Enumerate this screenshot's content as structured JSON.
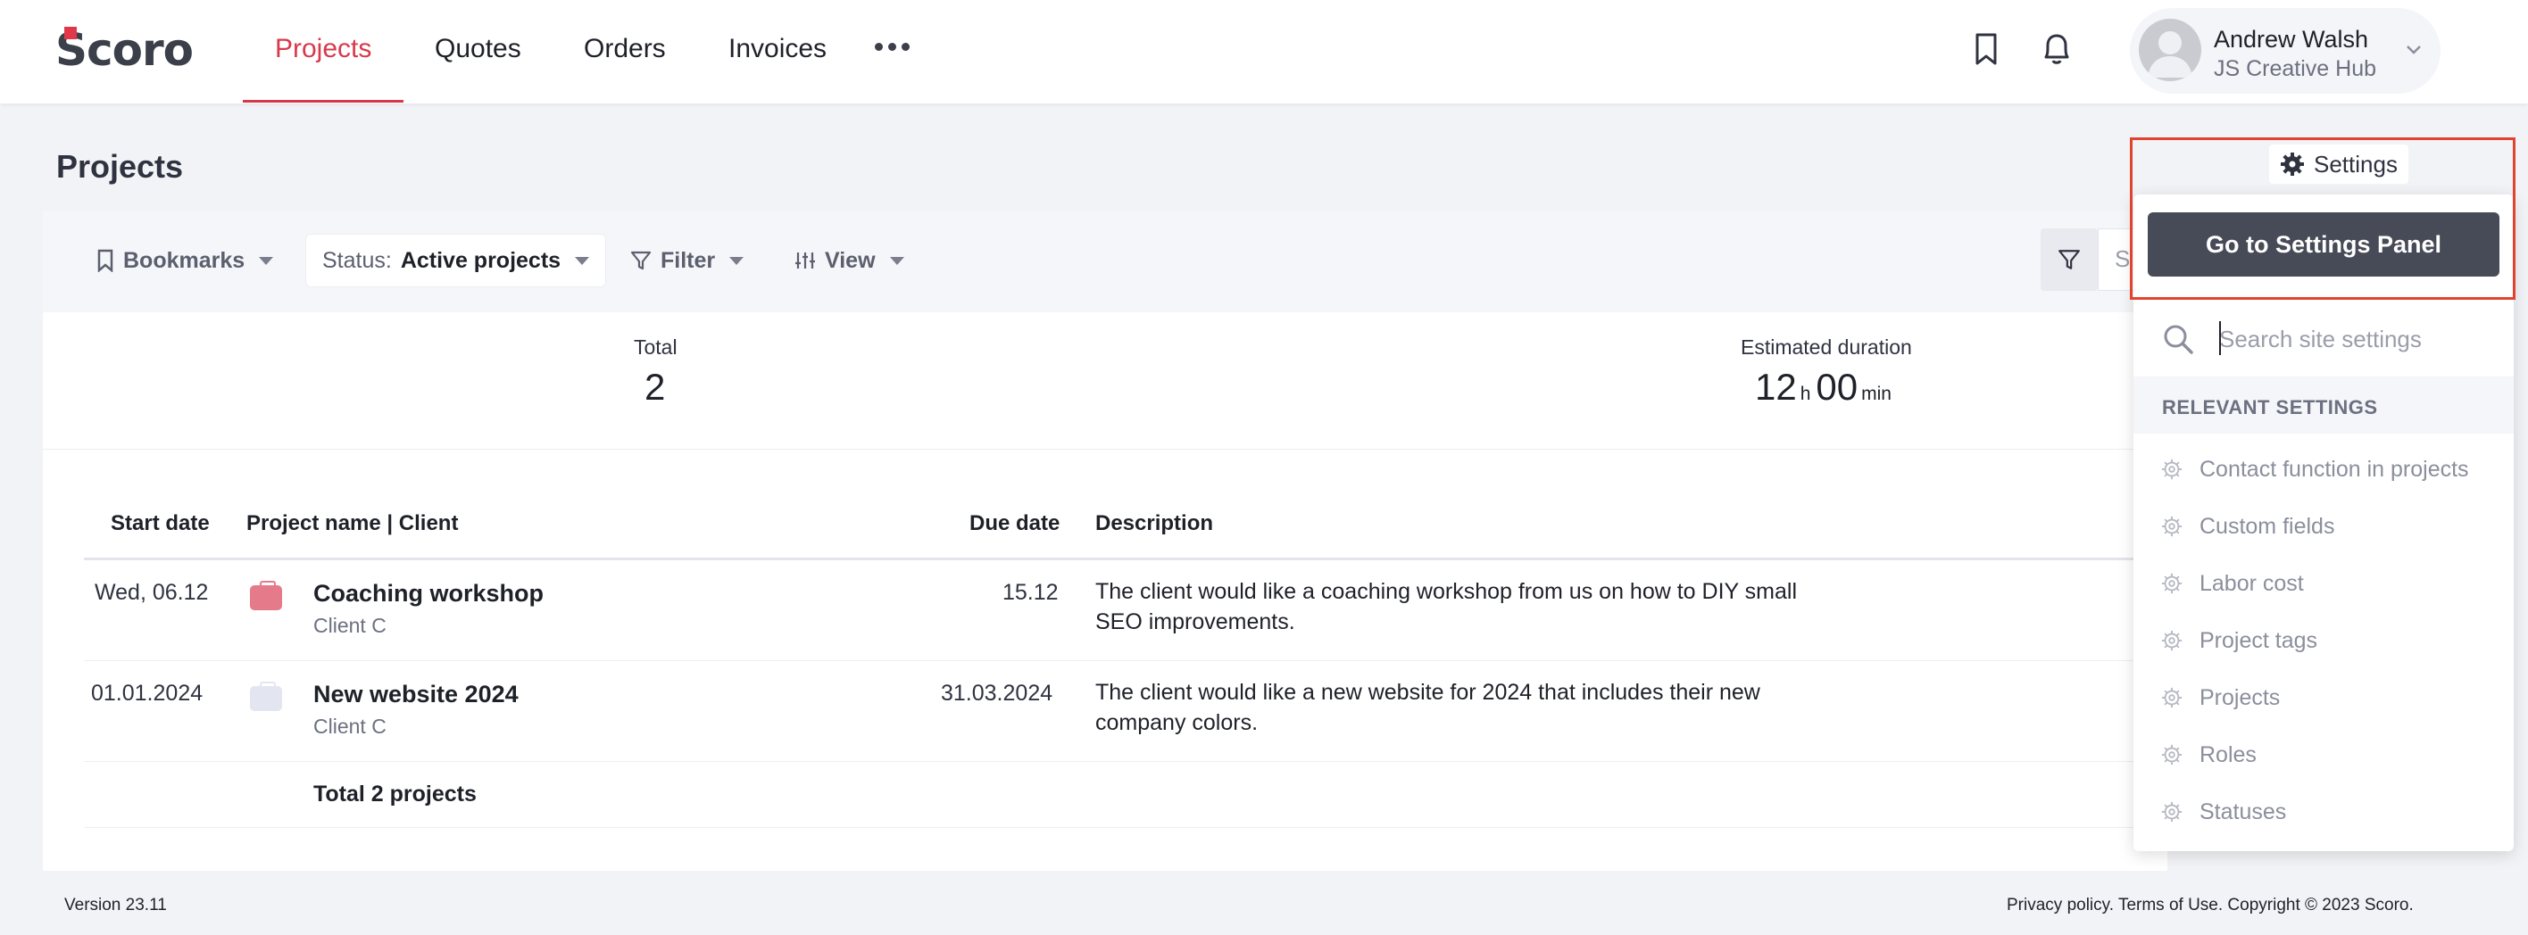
{
  "app": {
    "logo_text": "Scoro"
  },
  "nav": {
    "items": [
      {
        "label": "Projects",
        "active": true
      },
      {
        "label": "Quotes"
      },
      {
        "label": "Orders"
      },
      {
        "label": "Invoices"
      }
    ],
    "more_icon": "ellipsis-icon",
    "bookmark_icon": "bookmark-icon",
    "bell_icon": "bell-icon"
  },
  "user": {
    "name": "Andrew Walsh",
    "company": "JS Creative Hub"
  },
  "page": {
    "title": "Projects"
  },
  "toolbar": {
    "bookmarks": "Bookmarks",
    "status_prefix": "Status:",
    "status_value": "Active projects",
    "filter": "Filter",
    "view": "View",
    "search_stub": "S"
  },
  "stats": {
    "total_label": "Total",
    "total_value": "2",
    "duration_label": "Estimated duration",
    "duration_hours": "12",
    "duration_h_unit": "h",
    "duration_minutes": "00",
    "duration_min_unit": "min"
  },
  "table": {
    "headers": {
      "start": "Start date",
      "name": "Project name | Client",
      "due": "Due date",
      "desc": "Description"
    },
    "rows": [
      {
        "start": "Wed, 06.12",
        "name": "Coaching workshop",
        "client": "Client C",
        "due": "15.12",
        "desc": "The client would like a coaching workshop from us on how to DIY small SEO improvements.",
        "icon_color": "#e57a8a"
      },
      {
        "start": "01.01.2024",
        "name": "New website 2024",
        "client": "Client C",
        "due": "31.03.2024",
        "desc": "The client would like a new website for 2024 that includes their new company colors.",
        "icon_color": "#e3e6f0"
      }
    ],
    "total": "Total 2 projects"
  },
  "footer": {
    "version": "Version 23.11",
    "legal": "Privacy policy. Terms of Use. Copyright © 2023 Scoro."
  },
  "settings_menu": {
    "label": "Settings",
    "go_button": "Go to Settings Panel",
    "search_placeholder": "Search site settings",
    "relevant_title": "RELEVANT SETTINGS",
    "items": [
      "Contact function in projects",
      "Custom fields",
      "Labor cost",
      "Project tags",
      "Projects",
      "Roles",
      "Statuses"
    ]
  },
  "colors": {
    "accent": "#d8394a",
    "highlight_border": "#e2432f",
    "button_dark": "#474b57"
  }
}
